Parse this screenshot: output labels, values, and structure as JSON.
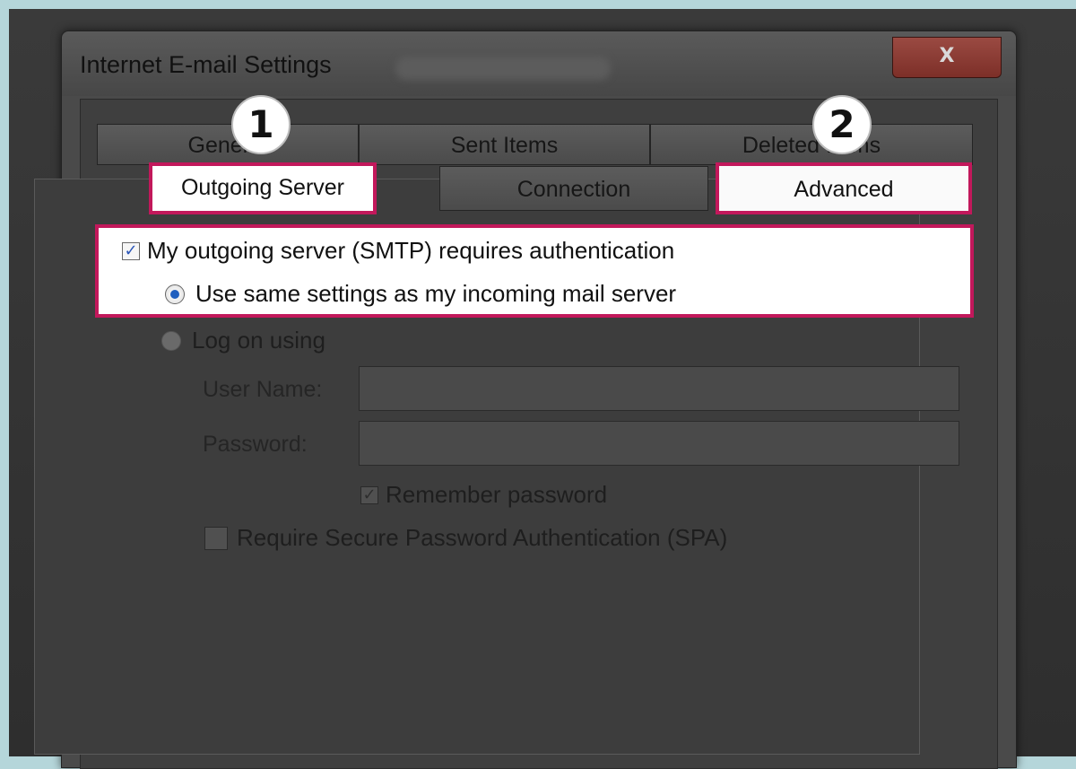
{
  "dialog": {
    "title": "Internet E-mail Settings",
    "close_label": "X"
  },
  "tabs": {
    "top": [
      "General",
      "Sent Items",
      "Deleted Items"
    ],
    "bottom": [
      "Outgoing Server",
      "Connection",
      "Advanced"
    ]
  },
  "badges": [
    "1",
    "2"
  ],
  "auth": {
    "requires_auth": "My outgoing server (SMTP) requires authentication",
    "requires_auth_checked": true,
    "use_same": "Use same settings as my incoming mail server",
    "log_on_using": "Log on using",
    "user_name_label": "User Name:",
    "user_name_value": "",
    "password_label": "Password:",
    "password_value": "",
    "remember_password": "Remember password",
    "remember_password_checked": true,
    "require_spa": "Require Secure Password Authentication (SPA)",
    "require_spa_checked": false
  },
  "colors": {
    "highlight": "#c2185b",
    "backdrop": "#b5d6da"
  }
}
